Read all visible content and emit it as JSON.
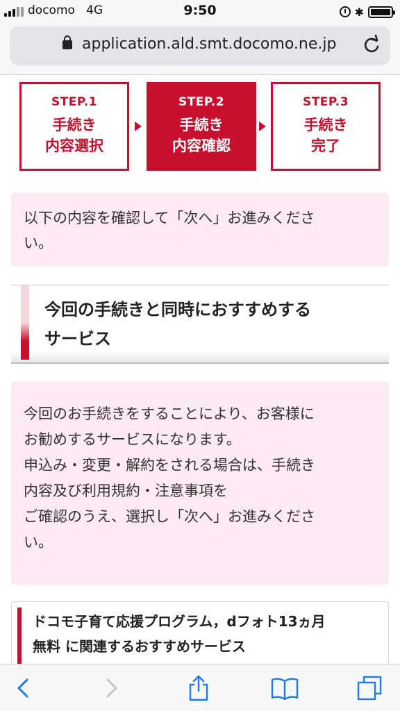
{
  "status_bar": {
    "carrier": "docomo",
    "network": "4G",
    "time": "9:50"
  },
  "browser": {
    "url": "application.ald.smt.docomo.ne.jp"
  },
  "steps": [
    {
      "label": "STEP.1",
      "name_line1": "手続き",
      "name_line2": "内容選択",
      "active": false
    },
    {
      "label": "STEP.2",
      "name_line1": "手続き",
      "name_line2": "内容確認",
      "active": true
    },
    {
      "label": "STEP.3",
      "name_line1": "手続き",
      "name_line2": "完了",
      "active": false
    }
  ],
  "notice": {
    "line1": "以下の内容を確認して「次へ」お進みくださ",
    "line2": "い。"
  },
  "section": {
    "title_line1": "今回の手続きと同時におすすめする",
    "title_line2": "サービス"
  },
  "description": {
    "lines": [
      "今回のお手続きをすることにより、お客様に",
      "お勧めするサービスになります。",
      "申込み・変更・解約をされる場合は、手続き",
      "内容及び利用規約・注意事項を",
      "ご確認のうえ、選択し「次へ」お進みくださ",
      "い。"
    ]
  },
  "card": {
    "title_line1": "ドコモ子育て応援プログラム，dフォト13ヵ月",
    "title_line2": "無料 に関連するおすすめサービス"
  },
  "colors": {
    "accent": "#c8102e",
    "pink_bg": "#fde9f3",
    "toolbar_icons": "#1a7cf5"
  },
  "toolbar": {
    "icons": [
      "back-icon",
      "forward-icon",
      "share-icon",
      "bookmarks-icon",
      "tabs-icon"
    ]
  }
}
